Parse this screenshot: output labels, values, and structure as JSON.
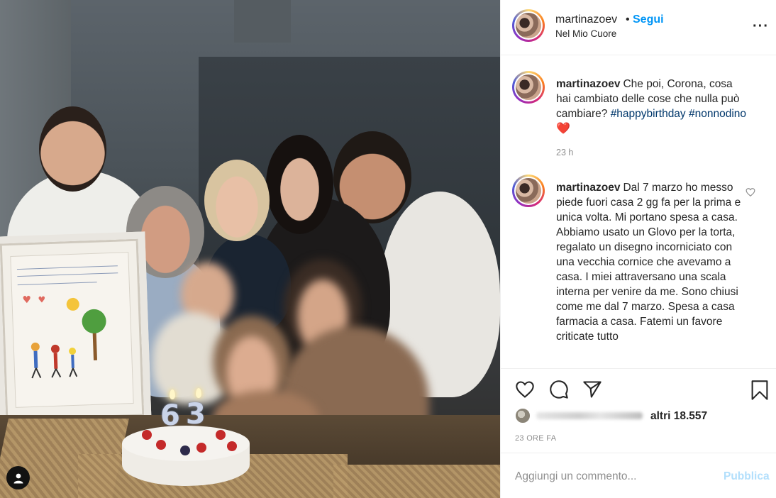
{
  "header": {
    "username": "martinazoev",
    "separator": "•",
    "follow_label": "Segui",
    "location": "Nel Mio Cuore",
    "more_icon": "more-options-icon"
  },
  "caption": {
    "username": "martinazoev",
    "text": "Che poi, Corona, cosa hai cambiato delle cose che nulla può cambiare?",
    "hashtag1": "#happybirthday",
    "hashtag2": "#nonnodino",
    "emoji": "❤️",
    "time": "23 h"
  },
  "comment": {
    "username": "martinazoev",
    "text": "Dal 7 marzo ho messo piede fuori casa 2 gg fa per la prima e unica volta. Mi portano spesa a casa. Abbiamo usato un Glovo per la torta, regalato un disegno incorniciato con una vecchia cornice che avevamo a casa. I miei attraversano una scala interna per venire da me. Sono chiusi come me dal 7 marzo. Spesa a casa farmacia a casa. Fatemi un favore criticate tutto"
  },
  "actions": {
    "like_icon": "heart-outline-icon",
    "comment_icon": "comment-bubble-icon",
    "share_icon": "paper-plane-icon",
    "save_icon": "bookmark-icon"
  },
  "likes": {
    "count_text": "altri 18.557"
  },
  "post_date": "23 ORE FA",
  "add_comment": {
    "placeholder": "Aggiungi un commento...",
    "publish_label": "Pubblica"
  },
  "colors": {
    "link_blue": "#0095f6",
    "hashtag_blue": "#00376b",
    "publish_disabled": "#b2dffc",
    "muted_gray": "#8e8e8e"
  }
}
